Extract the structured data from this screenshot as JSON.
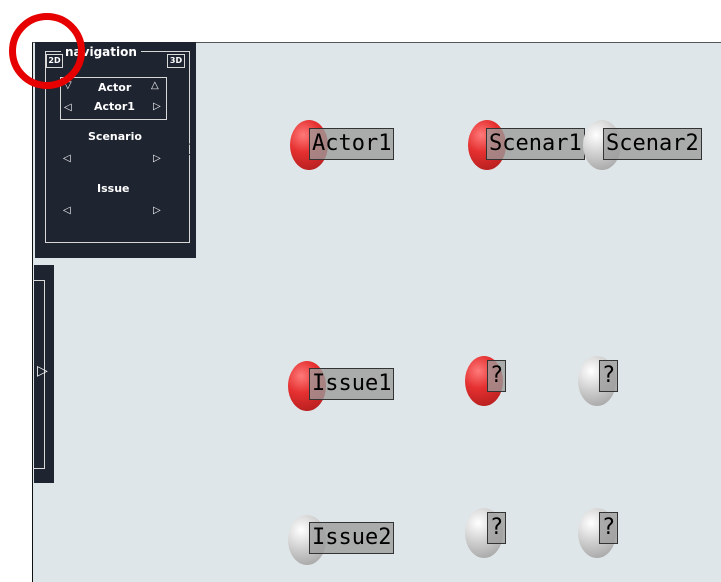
{
  "navigation": {
    "title": "navigation",
    "mode_2d": "2D",
    "mode_3d": "3D",
    "actor": {
      "heading": "Actor",
      "current": "Actor1"
    },
    "scenario": {
      "heading": "Scenario"
    },
    "issue": {
      "heading": "Issue"
    }
  },
  "nodes": [
    {
      "label": "Actor1",
      "color": "red"
    },
    {
      "label": "Scenar1",
      "color": "red"
    },
    {
      "label": "Scenar2",
      "color": "gray"
    },
    {
      "label": "Issue1",
      "color": "red"
    },
    {
      "label": "?",
      "color": "red"
    },
    {
      "label": "?",
      "color": "gray"
    },
    {
      "label": "Issue2",
      "color": "gray"
    },
    {
      "label": "?",
      "color": "gray"
    },
    {
      "label": "?",
      "color": "gray"
    }
  ],
  "colors": {
    "panel": "#1e2430",
    "canvas": "#dfe6e9",
    "node_red": "#e53030",
    "node_gray": "#cfcfcf",
    "highlight_ring": "#e60000"
  }
}
